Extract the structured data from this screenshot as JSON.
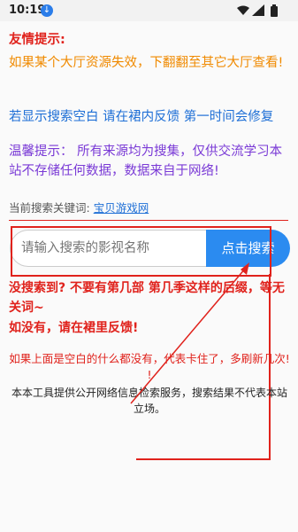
{
  "status": {
    "time": "10:19"
  },
  "notice": {
    "title": "友情提示:",
    "line1": "如果某个大厅资源失效，下翻翻至其它大厅查看!",
    "line2": "若显示搜索空白 请在裙内反馈 第一时间会修复",
    "line3": "温馨提示：  所有来源均为搜集，仅供交流学习本站不存储任何数据，数据来自于网络!"
  },
  "keyword": {
    "label": "当前搜索关键词: ",
    "value": "宝贝游戏网"
  },
  "search": {
    "placeholder": "请输入搜索的影视名称",
    "button": "点击搜索"
  },
  "tips": {
    "line1": "没搜索到? 不要有第几部 第几季这样的后缀，等无关词~",
    "line2": "如没有，请在裙里反馈!",
    "blank": "如果上面是空白的什么都没有，代表卡住了，多刷新几次! !"
  },
  "disclaimer": "本本工具提供公开网络信息检索服务，搜索结果不代表本站立场。",
  "colors": {
    "accent": "#2b8bf0",
    "alert": "#e0221c",
    "warn": "#f08a00"
  }
}
